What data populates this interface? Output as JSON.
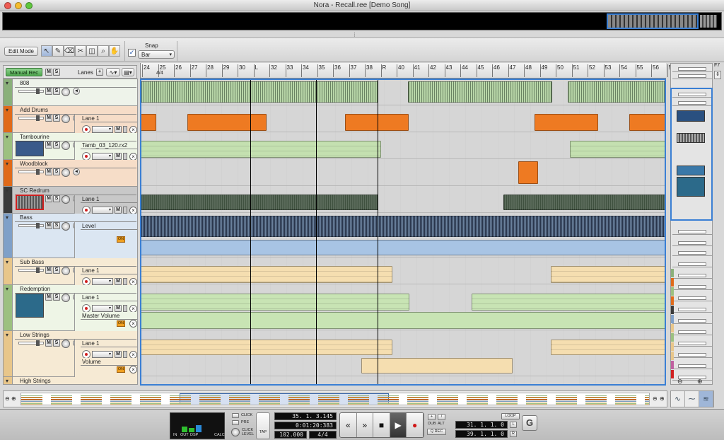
{
  "window": {
    "title": "Nora - Recall.ree [Demo Song]"
  },
  "toolbar": {
    "edit_mode": "Edit Mode",
    "tools": [
      {
        "name": "select-icon",
        "glyph": "↖"
      },
      {
        "name": "pencil-icon",
        "glyph": "✎"
      },
      {
        "name": "eraser-icon",
        "glyph": "⌫"
      },
      {
        "name": "razor-icon",
        "glyph": "✂"
      },
      {
        "name": "mute-tool-icon",
        "glyph": "◫"
      },
      {
        "name": "magnify-icon",
        "glyph": "⌕"
      },
      {
        "name": "hand-icon",
        "glyph": "✋"
      }
    ],
    "snap_label": "Snap",
    "snap_checked": "✓",
    "snap_value": "Bar"
  },
  "sequencer": {
    "manual_rec": "Manual Rec",
    "m": "M",
    "s": "S",
    "lanes_label": "Lanes",
    "lanes_add": "+"
  },
  "ruler": {
    "signature": "4/4",
    "bars": [
      "24",
      "25",
      "26",
      "27",
      "28",
      "29",
      "30",
      "L",
      "32",
      "33",
      "34",
      "35",
      "36",
      "37",
      "38",
      "R",
      "40",
      "41",
      "42",
      "43",
      "44",
      "45",
      "46",
      "47",
      "48",
      "49",
      "50",
      "51",
      "52",
      "53",
      "54",
      "55",
      "56",
      "5"
    ]
  },
  "tracks": [
    {
      "name": "808",
      "color": "#8ab07a",
      "bg": "#eef3ea"
    },
    {
      "name": "Add Drums",
      "color": "#e06a1a",
      "bg": "#f6ddc8",
      "lane": "Lane 1"
    },
    {
      "name": "Tambourine",
      "color": "#9cc080",
      "bg": "#eef5e6",
      "lane": "Tamb_03_120.rx2"
    },
    {
      "name": "Woodblock",
      "color": "#e06a1a",
      "bg": "#f6ddc8"
    },
    {
      "name": "SC Redrum",
      "color": "#3a3a3a",
      "bg": "#c8c8c8",
      "lane": "Lane 1"
    },
    {
      "name": "Bass",
      "color": "#7fa0c8",
      "bg": "#dbe6f2",
      "lane": "Level",
      "on": "ON"
    },
    {
      "name": "Sub Bass",
      "color": "#e8c68a",
      "bg": "#f6ead4",
      "lane": "Lane 1"
    },
    {
      "name": "Redemption",
      "color": "#9cc080",
      "bg": "#eef5e6",
      "lane": "Lane 1",
      "lane2": "Master Volume",
      "on": "ON"
    },
    {
      "name": "Low Strings",
      "color": "#e8c68a",
      "bg": "#f6ead4",
      "lane": "Lane 1",
      "lane2": "Volume",
      "on": "ON"
    },
    {
      "name": "High Strings",
      "color": "#e8c68a",
      "bg": "#f6ead4"
    }
  ],
  "rack": {
    "shortcut": "F7"
  },
  "transport": {
    "meters": {
      "in": "IN",
      "out": "OUT",
      "dsp": "DSP",
      "calc": "CALC"
    },
    "click": "CLICK",
    "pre": "PRE",
    "click_level": "CLICK\nLEVEL",
    "tap": "TAP",
    "position": "35. 1. 3.145",
    "time": "0:01:20:383",
    "tempo": "102.000",
    "signature": "4/4",
    "rewind_glyph": "«",
    "ffwd_glyph": "»",
    "stop_glyph": "■",
    "play_glyph": "▶",
    "record_glyph": "●",
    "plus": "+",
    "slash": "/",
    "dub": "DUB",
    "alt": "ALT",
    "q_rec": "Q REC",
    "loop": "LOOP",
    "loop_left": "31. 1. 1.  0",
    "loop_right": "39. 1. 1.  0",
    "l": "L",
    "r": "R",
    "g": "G"
  },
  "zoom": {
    "minus": "⊖",
    "plus": "⊕"
  },
  "colors": {
    "selection": "#3a7fd4"
  }
}
